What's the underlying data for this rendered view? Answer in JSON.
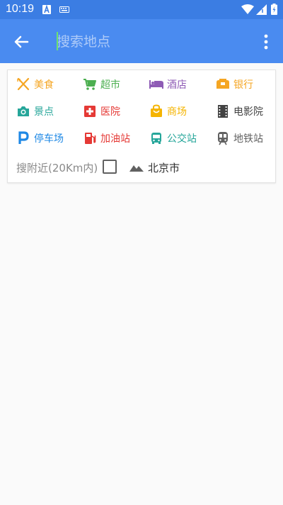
{
  "status_bar": {
    "time": "10:19",
    "icons": [
      "font-icon",
      "keyboard-icon",
      "wifi-icon",
      "signal-icon",
      "battery-icon"
    ]
  },
  "toolbar": {
    "search_placeholder": "搜索地点",
    "back_icon": "arrow-back-icon",
    "more_icon": "more-vert-icon"
  },
  "categories": [
    {
      "label": "美食",
      "icon": "restaurant-icon",
      "color": "#f5a623"
    },
    {
      "label": "超市",
      "icon": "cart-icon",
      "color": "#4caf50"
    },
    {
      "label": "酒店",
      "icon": "hotel-icon",
      "color": "#8e5bb5"
    },
    {
      "label": "银行",
      "icon": "bank-icon",
      "color": "#f5a623"
    },
    {
      "label": "景点",
      "icon": "camera-icon",
      "color": "#26a69a"
    },
    {
      "label": "医院",
      "icon": "hospital-icon",
      "color": "#e53935"
    },
    {
      "label": "商场",
      "icon": "shopping-bag-icon",
      "color": "#f5b400"
    },
    {
      "label": "电影院",
      "icon": "film-icon",
      "color": "#424242"
    },
    {
      "label": "停车场",
      "icon": "parking-icon",
      "color": "#1e88e5"
    },
    {
      "label": "加油站",
      "icon": "gas-station-icon",
      "color": "#e53935"
    },
    {
      "label": "公交站",
      "icon": "bus-icon",
      "color": "#26a69a"
    },
    {
      "label": "地铁站",
      "icon": "subway-icon",
      "color": "#616161"
    }
  ],
  "nearby": {
    "label": "搜附近(20Km内)",
    "checked": false,
    "city": "北京市",
    "city_icon": "terrain-icon"
  },
  "colors": {
    "status_bar": "#3b7de3",
    "toolbar": "#4a8bf0",
    "background": "#fafafa"
  }
}
